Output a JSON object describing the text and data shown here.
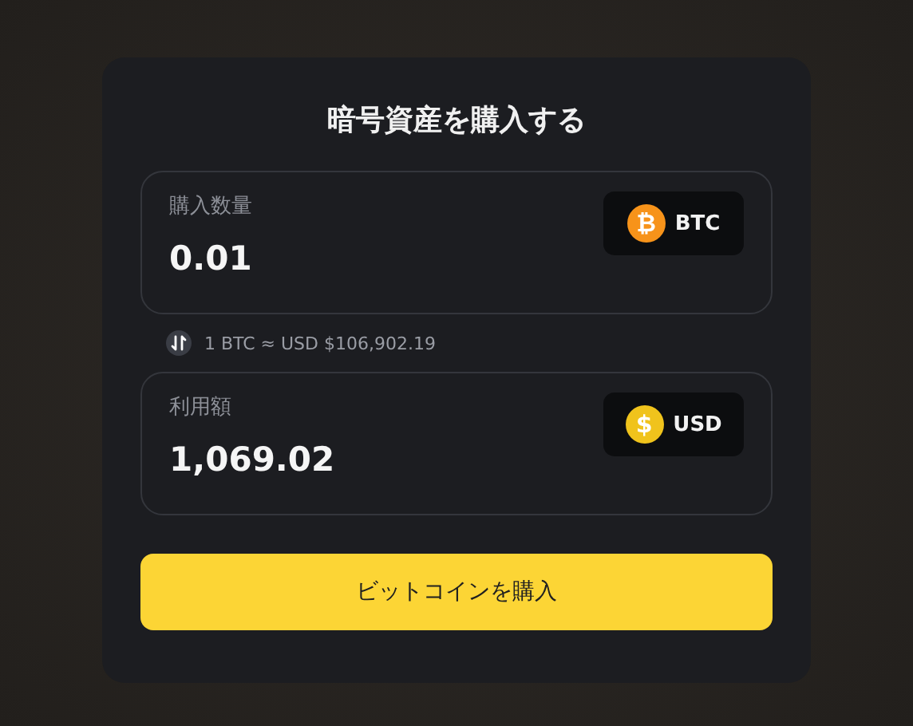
{
  "title": "暗号資産を購入する",
  "fields": [
    {
      "label": "購入数量",
      "value": "0.01",
      "currency": {
        "code": "BTC",
        "symbol": "₿",
        "color": "#f7931a"
      }
    },
    {
      "label": "利用額",
      "value": "1,069.02",
      "currency": {
        "code": "USD",
        "symbol": "$",
        "color": "#f0c31c"
      }
    }
  ],
  "rate": "1 BTC ≈ USD $106,902.19",
  "button": "ビットコインを購入"
}
